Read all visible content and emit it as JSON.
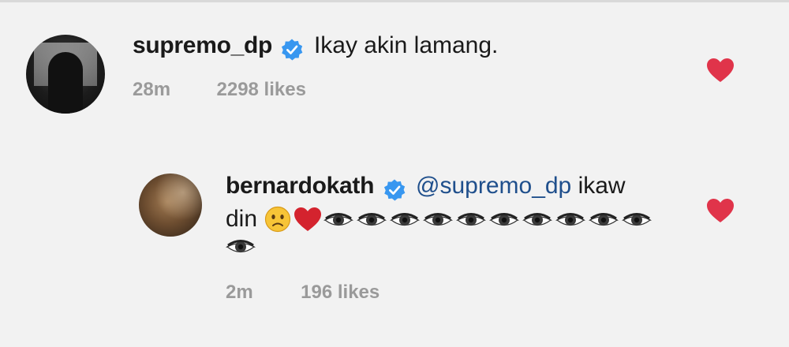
{
  "comments": [
    {
      "username": "supremo_dp",
      "text": "Ikay akin lamang.",
      "time": "28m",
      "likes": "2298 likes",
      "verified": true,
      "liked": true
    },
    {
      "username": "bernardokath",
      "mention": "@supremo_dp",
      "text_after_mention": " ikaw",
      "line2_text": "din ",
      "emojis": [
        "slightly-frowning-face",
        "red-heart",
        "eye",
        "eye",
        "eye",
        "eye",
        "eye",
        "eye",
        "eye",
        "eye",
        "eye",
        "eye",
        "eye"
      ],
      "time": "2m",
      "likes": "196 likes",
      "verified": true,
      "liked": true
    }
  ],
  "colors": {
    "background": "#f2f2f2",
    "verified_badge": "#3897f0",
    "heart": "#e0344a",
    "mention": "#1f4f8c",
    "meta_text": "#9a9a9a"
  }
}
